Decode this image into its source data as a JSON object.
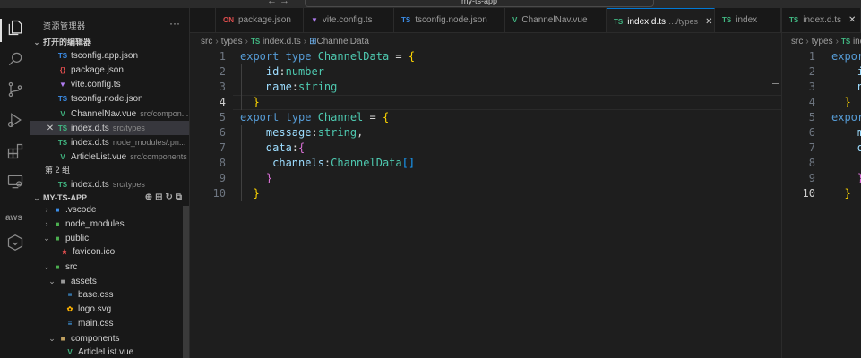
{
  "window": {
    "title": "my-ts-app",
    "nav_arrows": "← →"
  },
  "sidebar": {
    "header": "资源管理器",
    "more": "···",
    "open_editors_label": "打开的编辑器",
    "open_editors": [
      {
        "icon": "TS",
        "name": "tsconfig.app.json",
        "desc": ""
      },
      {
        "icon": "{}",
        "name": "package.json",
        "desc": ""
      },
      {
        "icon": "▼",
        "name": "vite.config.ts",
        "desc": ""
      },
      {
        "icon": "TS",
        "name": "tsconfig.node.json",
        "desc": ""
      },
      {
        "icon": "V",
        "name": "ChannelNav.vue",
        "desc": "src/compon..."
      },
      {
        "icon": "TS",
        "name": "index.d.ts",
        "desc": "src/types",
        "close": "✕"
      },
      {
        "icon": "TS",
        "name": "index.d.ts",
        "desc": "node_modules/.pn..."
      },
      {
        "icon": "V",
        "name": "ArticleList.vue",
        "desc": "src/components"
      }
    ],
    "group2_label": "第 2 组",
    "group2": [
      {
        "icon": "TS",
        "name": "index.d.ts",
        "desc": "src/types"
      }
    ],
    "project_label": "MY-TS-APP",
    "tree": [
      {
        "twisty": "›",
        "icon": "■",
        "name": ".vscode"
      },
      {
        "twisty": "›",
        "icon": "■",
        "name": "node_modules"
      },
      {
        "twisty": "⌄",
        "icon": "■",
        "name": "public"
      },
      {
        "twisty": "",
        "icon": "★",
        "name": "favicon.ico"
      },
      {
        "twisty": "⌄",
        "icon": "■",
        "name": "src"
      },
      {
        "twisty": "⌄",
        "icon": "■",
        "name": "assets"
      },
      {
        "twisty": "",
        "icon": "≡",
        "name": "base.css"
      },
      {
        "twisty": "",
        "icon": "✿",
        "name": "logo.svg"
      },
      {
        "twisty": "",
        "icon": "≡",
        "name": "main.css"
      },
      {
        "twisty": "⌄",
        "icon": "■",
        "name": "components"
      },
      {
        "twisty": "",
        "icon": "V",
        "name": "ArticleList.vue"
      }
    ]
  },
  "activity": {
    "aws": "aws"
  },
  "tabs": [
    {
      "icon": "ON",
      "name": "package.json",
      "sub": "",
      "close": ""
    },
    {
      "icon": "▼",
      "name": "vite.config.ts",
      "sub": "",
      "close": ""
    },
    {
      "icon": "TS",
      "name": "tsconfig.node.json",
      "sub": "",
      "close": ""
    },
    {
      "icon": "V",
      "name": "ChannelNav.vue",
      "sub": "",
      "close": ""
    },
    {
      "icon": "TS",
      "name": "index.d.ts",
      "sub": "…/types",
      "close": "✕"
    },
    {
      "icon": "TS",
      "name": "index",
      "sub": "",
      "close": ""
    },
    {
      "icon": "TS",
      "name": "index.d.ts",
      "sub": "",
      "close": "✕"
    }
  ],
  "breadcrumb": {
    "a": "src",
    "b": "types",
    "c_icon": "TS",
    "c": "index.d.ts",
    "d_icon": "⊞",
    "d": "ChannelData"
  },
  "editor": {
    "line_numbers": [
      "1",
      "2",
      "3",
      "4",
      "5",
      "6",
      "7",
      "8",
      "9",
      "10"
    ],
    "lines": [
      [
        {
          "t": "export type ",
          "c": "kw"
        },
        {
          "t": "ChannelData",
          "c": "ty"
        },
        {
          "t": " = ",
          "c": "pu"
        },
        {
          "t": "{",
          "c": "br1"
        }
      ],
      [
        {
          "t": "    id",
          "c": "pr"
        },
        {
          "t": ":",
          "c": "pu"
        },
        {
          "t": "number",
          "c": "ty"
        }
      ],
      [
        {
          "t": "    name",
          "c": "pr"
        },
        {
          "t": ":",
          "c": "pu"
        },
        {
          "t": "string",
          "c": "ty"
        }
      ],
      [
        {
          "t": "  }",
          "c": "br1"
        }
      ],
      [
        {
          "t": "export type ",
          "c": "kw"
        },
        {
          "t": "Channel",
          "c": "ty"
        },
        {
          "t": " = ",
          "c": "pu"
        },
        {
          "t": "{",
          "c": "br1"
        }
      ],
      [
        {
          "t": "    message",
          "c": "pr"
        },
        {
          "t": ":",
          "c": "pu"
        },
        {
          "t": "string",
          "c": "ty"
        },
        {
          "t": ",",
          "c": "pu"
        }
      ],
      [
        {
          "t": "    data",
          "c": "pr"
        },
        {
          "t": ":",
          "c": "pu"
        },
        {
          "t": "{",
          "c": "br2"
        }
      ],
      [
        {
          "t": "     channels",
          "c": "pr"
        },
        {
          "t": ":",
          "c": "pu"
        },
        {
          "t": "ChannelData",
          "c": "ty"
        },
        {
          "t": "[]",
          "c": "br3"
        }
      ],
      [
        {
          "t": "    }",
          "c": "br2"
        }
      ],
      [
        {
          "t": "  }",
          "c": "br1"
        }
      ]
    ],
    "current_line": "4"
  },
  "right_pane": {
    "breadcrumb": {
      "a": "src",
      "b": "types",
      "c_icon": "TS",
      "c": "index.d.ts"
    },
    "current_line": "10",
    "lines": [
      [
        {
          "t": "expor",
          "c": "kw"
        }
      ],
      [
        {
          "t": "    i",
          "c": "pr"
        }
      ],
      [
        {
          "t": "    n",
          "c": "pr"
        }
      ],
      [
        {
          "t": "  }",
          "c": "br1"
        }
      ],
      [
        {
          "t": "expor",
          "c": "kw"
        }
      ],
      [
        {
          "t": "    m",
          "c": "pr"
        }
      ],
      [
        {
          "t": "    d",
          "c": "pr"
        }
      ],
      [
        {
          "t": "     ",
          "c": "pr"
        }
      ],
      [
        {
          "t": "    }",
          "c": "br2"
        }
      ],
      [
        {
          "t": "  }",
          "c": "br1"
        }
      ]
    ]
  }
}
